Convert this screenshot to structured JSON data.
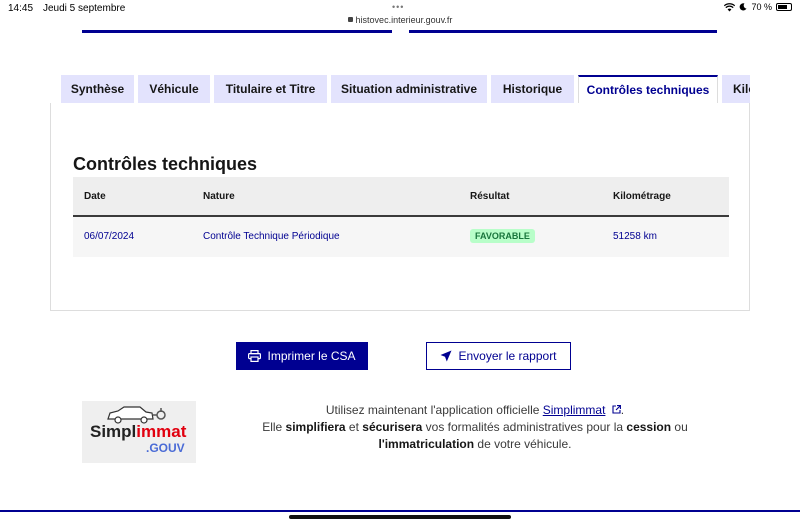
{
  "status_bar": {
    "time": "14:45",
    "date": "Jeudi 5 septembre",
    "url": "histovec.interieur.gouv.fr",
    "battery": "70 %"
  },
  "tabs": [
    {
      "label": "Synthèse",
      "active": false
    },
    {
      "label": "Véhicule",
      "active": false
    },
    {
      "label": "Titulaire et Titre",
      "active": false
    },
    {
      "label": "Situation administrative",
      "active": false
    },
    {
      "label": "Historique",
      "active": false
    },
    {
      "label": "Contrôles techniques",
      "active": true
    },
    {
      "label": "Kilo",
      "active": false
    }
  ],
  "section": {
    "title": "Contrôles techniques",
    "columns": [
      "Date",
      "Nature",
      "Résultat",
      "Kilométrage"
    ],
    "rows": [
      {
        "date": "06/07/2024",
        "nature": "Contrôle Technique Périodique",
        "result": "FAVORABLE",
        "km": "51258 km"
      }
    ]
  },
  "actions": {
    "print_label": "Imprimer le CSA",
    "send_label": "Envoyer le rapport"
  },
  "promo": {
    "logo_text_a": "Simpl",
    "logo_text_b": "immat",
    "logo_gouv": ".GOUV",
    "line1_pre": "Utilisez maintenant l'application officielle ",
    "line1_link": "Simplimmat",
    "line1_post": ".",
    "line2_pre": "Elle ",
    "line2_b1": "simplifiera",
    "line2_mid": " et ",
    "line2_b2": "sécurisera",
    "line2_post": " vos formalités administratives pour la ",
    "line2_b3": "cession",
    "line2_end": " ou",
    "line3_b": "l'immatriculation",
    "line3_post": " de votre véhicule."
  },
  "colors": {
    "primary": "#000091",
    "tab_bg": "#e3e3fd",
    "badge_bg": "#b8fec9",
    "badge_text": "#18753c"
  }
}
